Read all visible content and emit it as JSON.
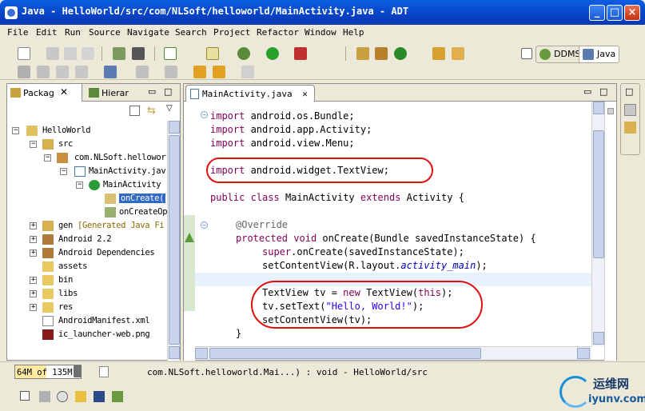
{
  "window": {
    "title": "Java - HelloWorld/src/com/NLSoft/helloworld/MainActivity.java - ADT"
  },
  "menu": [
    "File",
    "Edit",
    "Run",
    "Source",
    "Navigate",
    "Search",
    "Project",
    "Refactor",
    "Window",
    "Help"
  ],
  "perspectives": {
    "ddms": "DDMS",
    "java": "Java"
  },
  "left_panel": {
    "tabs": [
      "Packag",
      "Hierar"
    ],
    "tree": [
      {
        "label": "HelloWorld"
      },
      {
        "label": "src"
      },
      {
        "label": "com.NLSoft.hellowor"
      },
      {
        "label": "MainActivity.jav"
      },
      {
        "label": "MainActivity"
      },
      {
        "label": "onCreate("
      },
      {
        "label": "onCreateOp"
      },
      {
        "label": "gen",
        "suffix": "[Generated Java Fi"
      },
      {
        "label": "Android 2.2"
      },
      {
        "label": "Android Dependencies"
      },
      {
        "label": "assets"
      },
      {
        "label": "bin"
      },
      {
        "label": "libs"
      },
      {
        "label": "res"
      },
      {
        "label": "AndroidManifest.xml"
      },
      {
        "label": "ic_launcher-web.png"
      }
    ]
  },
  "editor": {
    "tab": "MainActivity.java",
    "code": {
      "l1_kw": "import",
      "l1": " android.os.Bundle;",
      "l2_kw": "import",
      "l2": " android.app.Activity;",
      "l3_kw": "import",
      "l3": " android.view.Menu;",
      "l4_kw": "import",
      "l4": " android.widget.TextView;",
      "l5_kw1": "public",
      "l5_kw2": "class",
      "l5a": " MainActivity ",
      "l5_kw3": "extends",
      "l5b": " Activity {",
      "l6": "@Override",
      "l7_kw1": "protected",
      "l7_kw2": "void",
      "l7": " onCreate(Bundle savedInstanceState) {",
      "l8_kw": "super",
      "l8": ".onCreate(savedInstanceState);",
      "l9a": "setContentView(R.layout.",
      "l9_fld": "activity_main",
      "l9b": ");",
      "l10a": "TextView tv = ",
      "l10_kw1": "new",
      "l10b": " TextView(",
      "l10_kw2": "this",
      "l10c": ");",
      "l11a": "tv.setText(",
      "l11_str": "\"Hello, World!\"",
      "l11b": ");",
      "l12": "setContentView(tv);",
      "l13": "}"
    }
  },
  "status": {
    "heap_used": "64M",
    "heap_of": "of",
    "heap_total": "135M",
    "heap_fill_fraction": 0.47,
    "text": "com.NLSoft.helloworld.Mai...) : void - HelloWorld/src"
  },
  "watermark": {
    "brand": "运维网",
    "url": "iyunv.com"
  },
  "colors": {
    "keyword": "#7f0055",
    "string": "#2a00ff",
    "annotation": "#646464",
    "highlight_circle": "#e01010",
    "titlebar": "#0842c4"
  }
}
